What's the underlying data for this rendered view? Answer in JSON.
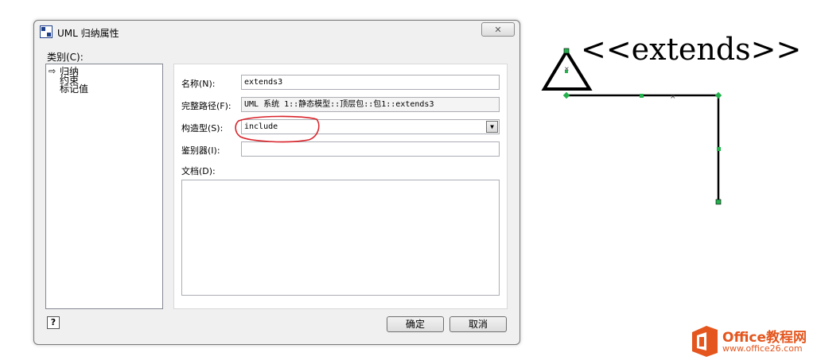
{
  "dialog": {
    "title": "UML 归纳属性",
    "close_label": "✕",
    "category_label": "类别(C):",
    "tree_items": [
      "归纳",
      "约束",
      "标记值"
    ],
    "fields": {
      "name_label": "名称(N):",
      "name_value": "extends3",
      "fullpath_label": "完整路径(F):",
      "fullpath_value": "UML 系统 1::静态模型::顶层包::包1::extends3",
      "stereotype_label": "构造型(S):",
      "stereotype_value": "include",
      "discriminator_label": "鉴别器(I):",
      "discriminator_value": "",
      "documentation_label": "文档(D):"
    },
    "buttons": {
      "help": "?",
      "ok": "确定",
      "cancel": "取消"
    }
  },
  "diagram": {
    "stereotype_text": "<<extends>>"
  },
  "watermark": {
    "brand": "Office教程网",
    "url": "www.office26.com"
  },
  "colors": {
    "highlight_circle": "#d9232a",
    "logo": "#e4561e",
    "handle": "#22b14c"
  }
}
